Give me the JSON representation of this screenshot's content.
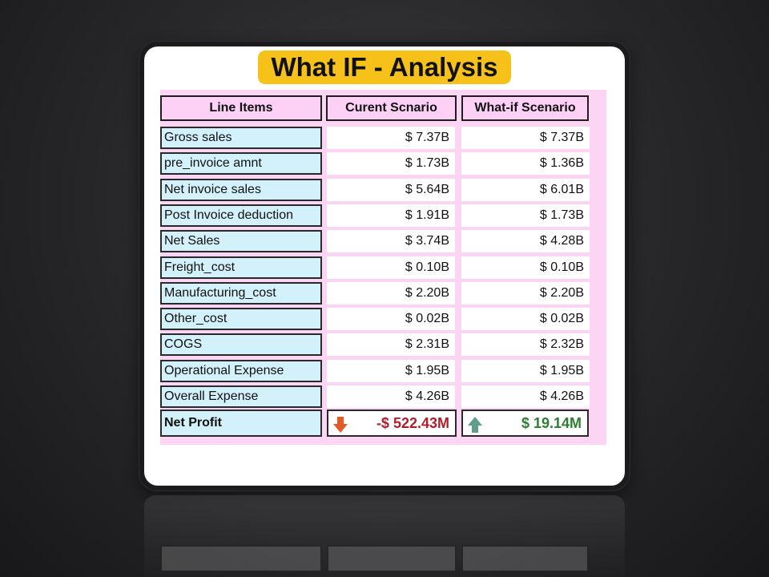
{
  "title": "What IF - Analysis",
  "table": {
    "headers": [
      "Line Items",
      "Curent Scnario",
      "What-if Scenario"
    ],
    "rows": [
      {
        "item": "Gross sales",
        "current": "$ 7.37B",
        "whatif": "$ 7.37B"
      },
      {
        "item": "pre_invoice amnt",
        "current": "$ 1.73B",
        "whatif": "$ 1.36B"
      },
      {
        "item": "Net invoice sales",
        "current": "$ 5.64B",
        "whatif": "$ 6.01B"
      },
      {
        "item": "Post Invoice deduction",
        "current": "$ 1.91B",
        "whatif": "$ 1.73B"
      },
      {
        "item": "Net Sales",
        "current": "$ 3.74B",
        "whatif": "$ 4.28B"
      },
      {
        "item": "Freight_cost",
        "current": "$ 0.10B",
        "whatif": "$ 0.10B"
      },
      {
        "item": "Manufacturing_cost",
        "current": "$ 2.20B",
        "whatif": "$ 2.20B"
      },
      {
        "item": "Other_cost",
        "current": "$ 0.02B",
        "whatif": "$ 0.02B"
      },
      {
        "item": "COGS",
        "current": "$ 2.31B",
        "whatif": "$ 2.32B"
      },
      {
        "item": "Operational Expense",
        "current": "$ 1.95B",
        "whatif": "$ 1.95B"
      },
      {
        "item": "Overall Expense",
        "current": "$ 4.26B",
        "whatif": "$ 4.26B"
      }
    ],
    "net_profit": {
      "label": "Net Profit",
      "current": "-$ 522.43M",
      "current_icon": "arrow-down-icon",
      "current_color": "#b01e2a",
      "whatif": "$ 19.14M",
      "whatif_icon": "arrow-up-icon",
      "whatif_color": "#2e7d32"
    }
  },
  "colors": {
    "title_bg": "#f6c21a",
    "header_bg": "#fdd1f6",
    "label_bg": "#d3f1fb",
    "panel_bg": "#fcd4f4"
  }
}
